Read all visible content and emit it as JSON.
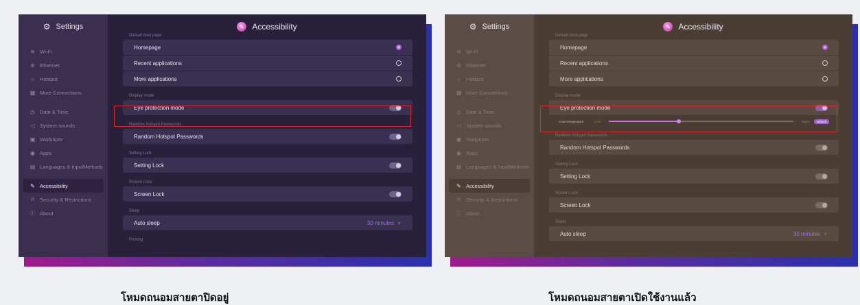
{
  "left_panel": {
    "sidebar": {
      "title": "Settings",
      "items": [
        {
          "icon": "wifi-icon",
          "glyph": "≋",
          "label": "Wi-Fi"
        },
        {
          "icon": "ethernet-icon",
          "glyph": "⊛",
          "label": "Ethernet"
        },
        {
          "icon": "hotspot-icon",
          "glyph": "☼",
          "label": "Hotspot"
        },
        {
          "icon": "more-connections-icon",
          "glyph": "▦",
          "label": "More Connections"
        },
        {
          "icon": "clock-icon",
          "glyph": "◷",
          "label": "Date & Time"
        },
        {
          "icon": "speaker-icon",
          "glyph": "◁",
          "label": "System sounds"
        },
        {
          "icon": "wallpaper-icon",
          "glyph": "▣",
          "label": "Wallpaper"
        },
        {
          "icon": "apps-icon",
          "glyph": "◉",
          "label": "Apps"
        },
        {
          "icon": "language-icon",
          "glyph": "▤",
          "label": "Languages & InputMethods"
        },
        {
          "icon": "accessibility-icon",
          "glyph": "✎",
          "label": "Accessibility"
        },
        {
          "icon": "lock-icon",
          "glyph": "⍾",
          "label": "Security & Restrictions"
        },
        {
          "icon": "info-icon",
          "glyph": "ⓘ",
          "label": "About"
        }
      ]
    },
    "main": {
      "title": "Accessibility",
      "default_boot_page_label": "Default boot page",
      "homepage": "Homepage",
      "recent_applications": "Recent applications",
      "more_applications": "More applications",
      "display_mode_label": "Display mode",
      "eye_protection_mode": "Eye protection mode",
      "random_hotspot_passwords_label": "Random Hotspot Passwords",
      "random_hotspot_passwords": "Random Hotspot Passwords",
      "setting_lock_label": "Setting Lock",
      "setting_lock": "Setting Lock",
      "screen_lock_label": "Screen Lock",
      "screen_lock": "Screen Lock",
      "sleep_label": "Sleep",
      "auto_sleep": "Auto sleep",
      "auto_sleep_value": "30 minutes",
      "printing_label": "Printing"
    }
  },
  "right_panel": {
    "main": {
      "color_temperature_label": "Color temperature",
      "cool_label": "Cool",
      "warm_label": "Warm",
      "default_button": "Default",
      "color_temperature_level": 0.38
    }
  },
  "captions": {
    "left": "โหมดถนอมสายตาปิดอยู่",
    "right": "โหมดถนอมสายตาเปิดใช้งานแล้ว"
  },
  "colors": {
    "highlight_box": "#e3242b",
    "accent": "#b15cd9"
  }
}
